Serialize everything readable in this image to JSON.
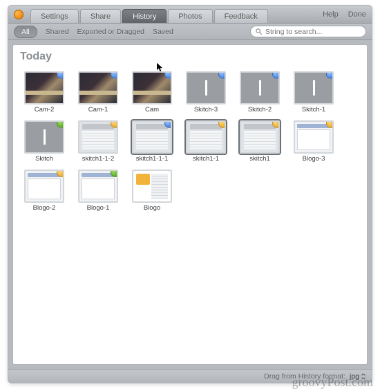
{
  "toolbar": {
    "tabs": [
      {
        "label": "Settings",
        "active": false
      },
      {
        "label": "Share",
        "active": false
      },
      {
        "label": "History",
        "active": true
      },
      {
        "label": "Photos",
        "active": false
      },
      {
        "label": "Feedback",
        "active": false
      }
    ],
    "help_label": "Help",
    "done_label": "Done"
  },
  "filters": {
    "items": [
      {
        "label": "All",
        "active": true
      },
      {
        "label": "Shared",
        "active": false
      },
      {
        "label": "Exported or Dragged",
        "active": false
      },
      {
        "label": "Saved",
        "active": false
      }
    ]
  },
  "search": {
    "placeholder": "String to search..."
  },
  "section": {
    "title": "Today"
  },
  "thumbs": [
    {
      "label": "Cam-2",
      "kind": "photo",
      "badge": "blue",
      "selected": false
    },
    {
      "label": "Cam-1",
      "kind": "photo",
      "badge": "blue",
      "selected": false
    },
    {
      "label": "Cam",
      "kind": "photo",
      "badge": "blue",
      "selected": false
    },
    {
      "label": "Skitch-3",
      "kind": "blank",
      "badge": "blue",
      "selected": false
    },
    {
      "label": "Skitch-2",
      "kind": "blank",
      "badge": "blue",
      "selected": false
    },
    {
      "label": "Skitch-1",
      "kind": "blank",
      "badge": "blue",
      "selected": false
    },
    {
      "label": "Skitch",
      "kind": "blank",
      "badge": "green",
      "selected": false
    },
    {
      "label": "skitch1-1-2",
      "kind": "screen",
      "badge": "orange",
      "selected": false
    },
    {
      "label": "skitch1-1-1",
      "kind": "screen",
      "badge": "blue",
      "selected": true
    },
    {
      "label": "skitch1-1",
      "kind": "screen",
      "badge": "orange",
      "selected": true
    },
    {
      "label": "skitch1",
      "kind": "screen",
      "badge": "orange",
      "selected": true
    },
    {
      "label": "Blogo-3",
      "kind": "browser",
      "badge": "orange",
      "selected": false
    },
    {
      "label": "Blogo-2",
      "kind": "browser",
      "badge": "orange",
      "selected": false
    },
    {
      "label": "Blogo-1",
      "kind": "browser",
      "badge": "green",
      "selected": false
    },
    {
      "label": "Blogo",
      "kind": "blogo",
      "badge": "",
      "selected": false
    }
  ],
  "footer": {
    "label": "Drag from History format:",
    "value": "jpg"
  },
  "watermark": "groovyPost.com"
}
